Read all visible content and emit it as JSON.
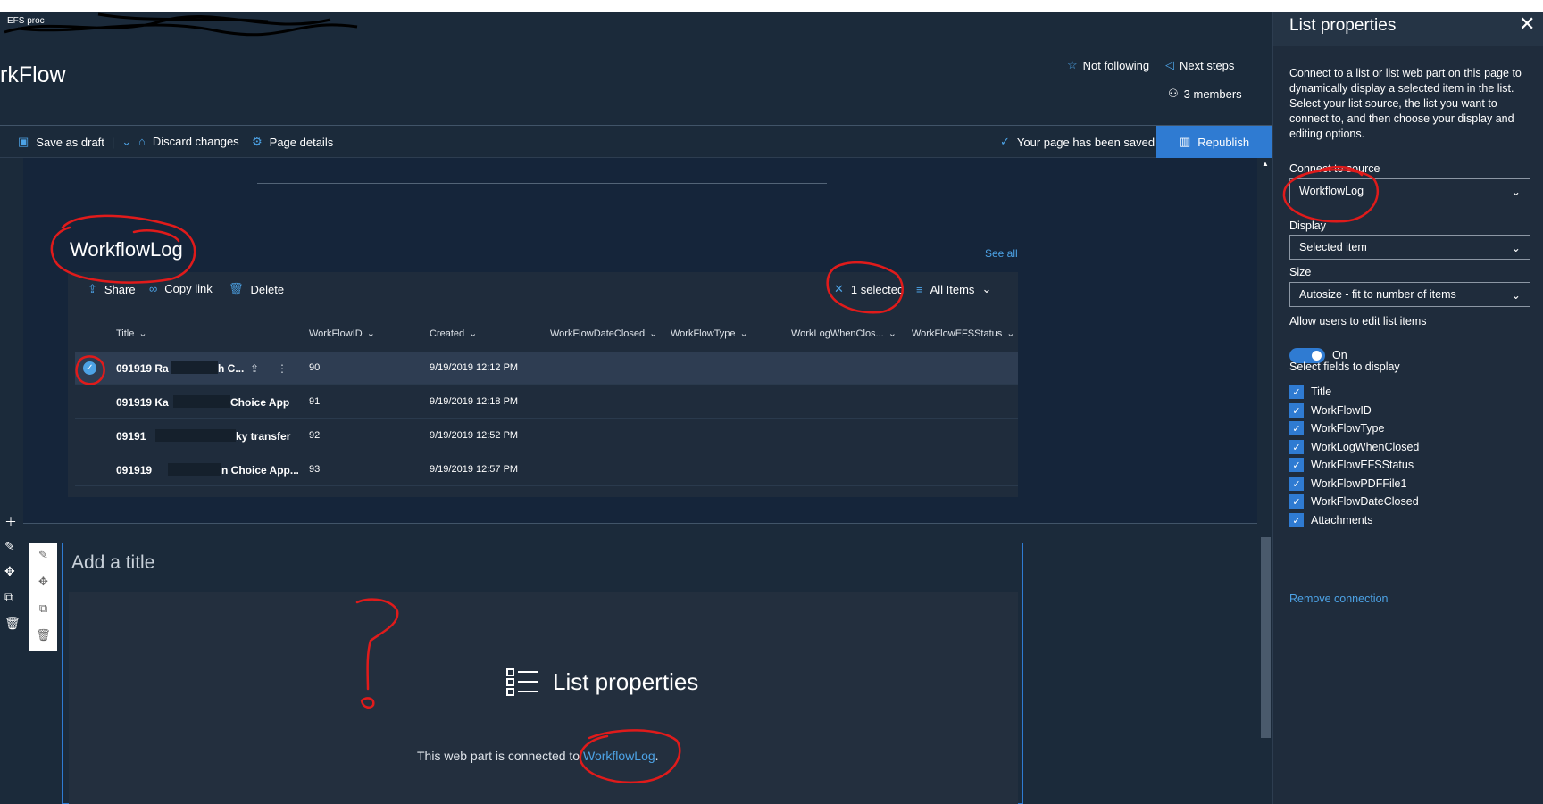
{
  "site": {
    "title": "rkFlow",
    "breadcrumb_hint": "EFS proc"
  },
  "header": {
    "follow_label": "Not following",
    "next_steps_label": "Next steps",
    "members_label": "3 members"
  },
  "commandbar": {
    "save_draft_label": "Save as draft",
    "discard_label": "Discard changes",
    "page_details_label": "Page details",
    "saved_status": "Your page has been saved",
    "republish_label": "Republish"
  },
  "webpart1": {
    "title": "WorkflowLog",
    "see_all_label": "See all",
    "commands": {
      "share": "Share",
      "copy_link": "Copy link",
      "delete": "Delete",
      "selected": "1 selected",
      "view": "All Items"
    },
    "columns": [
      "Title",
      "WorkFlowID",
      "Created",
      "WorkFlowDateClosed",
      "WorkFlowType",
      "WorkLogWhenClos...",
      "WorkFlowEFSStatus"
    ],
    "rows": [
      {
        "title_start": "091919 Ra",
        "title_end": "h C...",
        "id": "90",
        "created": "9/19/2019 12:12 PM",
        "selected": true
      },
      {
        "title_start": "091919 Ka",
        "title_end": "Choice App",
        "id": "91",
        "created": "9/19/2019 12:18 PM",
        "selected": false
      },
      {
        "title_start": "09191",
        "title_end": "ky transfer",
        "id": "92",
        "created": "9/19/2019 12:52 PM",
        "selected": false
      },
      {
        "title_start": "091919 ",
        "title_end": "n Choice App...",
        "id": "93",
        "created": "9/19/2019 12:57 PM",
        "selected": false
      }
    ]
  },
  "webpart2": {
    "title_placeholder": "Add a title",
    "heading": "List properties",
    "connected_text": "This web part is connected to ",
    "connected_link": "WorkflowLog",
    "connected_suffix": "."
  },
  "panel": {
    "title": "List properties",
    "description": "Connect to a list or list web part on this page to dynamically display a selected item in the list. Select your list source, the list you want to connect to, and then choose your display and editing options.",
    "connect_label": "Connect to source",
    "connect_value": "WorkflowLog",
    "display_label": "Display",
    "display_value": "Selected item",
    "size_label": "Size",
    "size_value": "Autosize - fit to number of items",
    "edit_label": "Allow users to edit list items",
    "edit_state": "On",
    "fields_label": "Select fields to display",
    "fields": [
      "Title",
      "WorkFlowID",
      "WorkFlowType",
      "WorkLogWhenClosed",
      "WorkFlowEFSStatus",
      "WorkFlowPDFFile1",
      "WorkFlowDateClosed",
      "Attachments"
    ],
    "remove_label": "Remove connection"
  },
  "colors": {
    "background": "#1b2a3a",
    "accent": "#2f7bd2",
    "link": "#4da3e6",
    "annotation": "#e01b1b"
  }
}
